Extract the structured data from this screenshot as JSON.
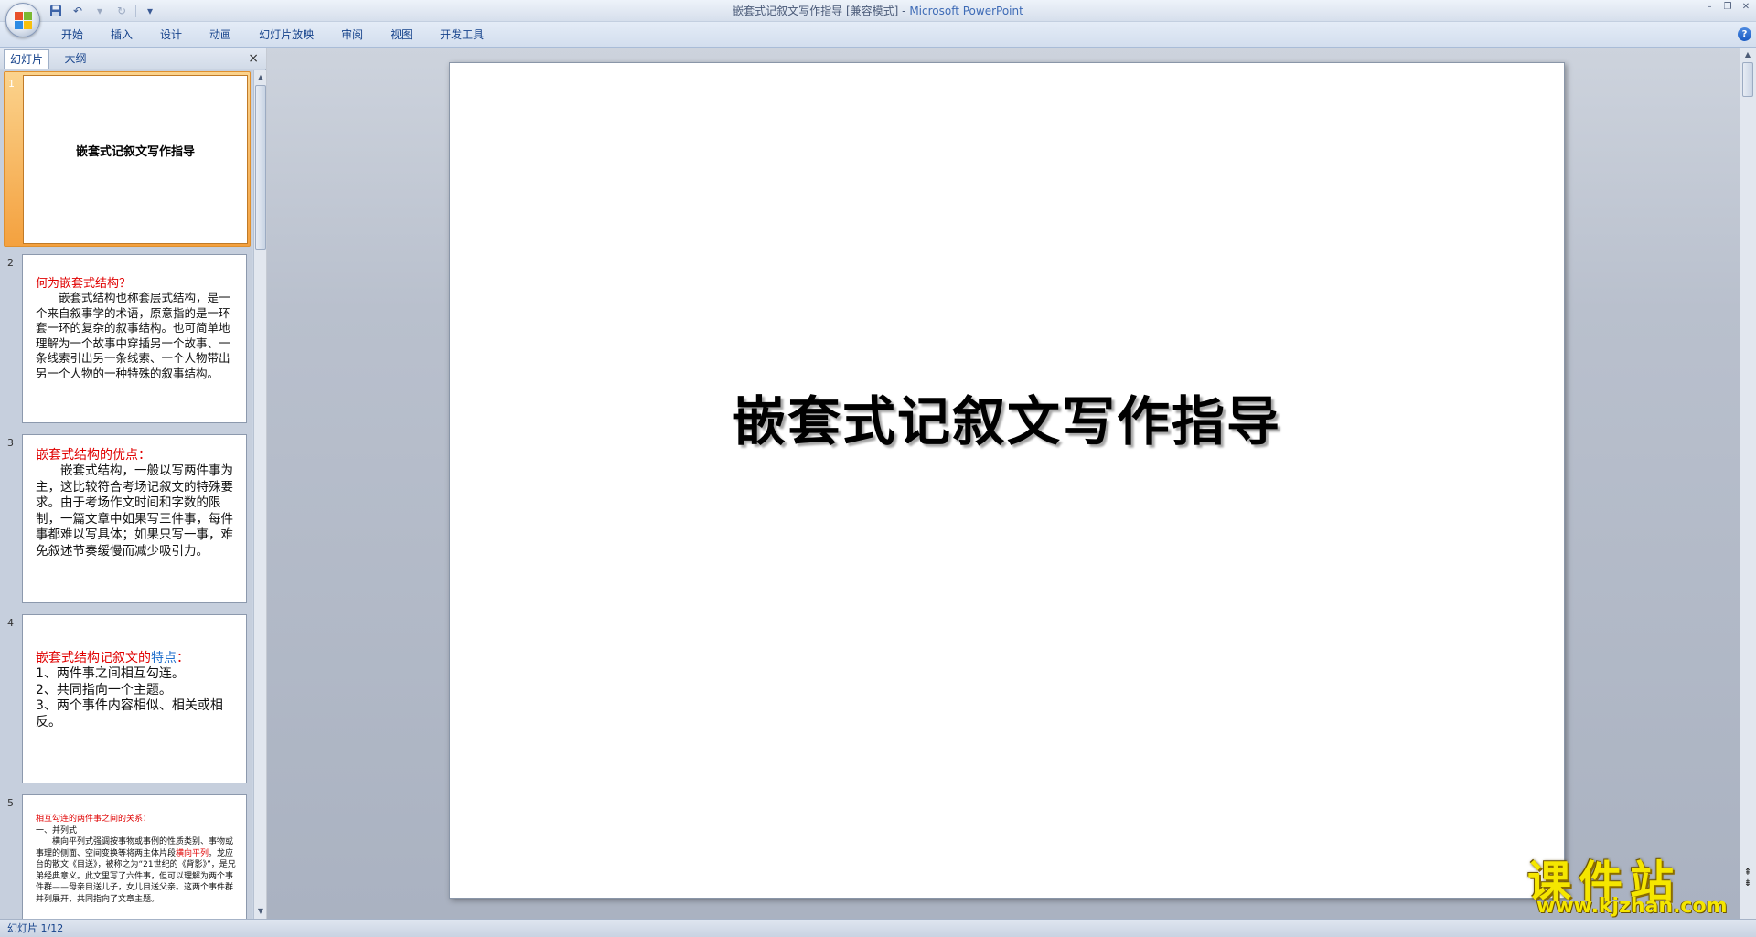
{
  "window": {
    "doc_title": "嵌套式记叙文写作指导 [兼容模式]",
    "separator": " - ",
    "app_name": "Microsoft PowerPoint"
  },
  "ribbon": {
    "tabs": [
      "开始",
      "插入",
      "设计",
      "动画",
      "幻灯片放映",
      "审阅",
      "视图",
      "开发工具"
    ]
  },
  "left_pane": {
    "tab_slides": "幻灯片",
    "tab_outline": "大纲",
    "close": "×"
  },
  "thumbnails": {
    "nums": [
      "1",
      "2",
      "3",
      "4",
      "5"
    ],
    "s1": {
      "title": "嵌套式记叙文写作指导"
    },
    "s2": {
      "heading": "何为嵌套式结构？",
      "body": "　　嵌套式结构也称套层式结构，是一个来自叙事学的术语，原意指的是一环套一环的复杂的叙事结构。也可简单地理解为一个故事中穿插另一个故事、一条线索引出另一条线索、一个人物带出另一个人物的一种特殊的叙事结构。"
    },
    "s3": {
      "heading": "嵌套式结构的优点：",
      "body": "　　嵌套式结构，一般以写两件事为主，这比较符合考场记叙文的特殊要求。由于考场作文时间和字数的限制，一篇文章中如果写三件事，每件事都难以写具体；如果只写一事，难免叙述节奏缓慢而减少吸引力。"
    },
    "s4": {
      "heading_red": "嵌套式结构记叙文的",
      "heading_blue": "特点",
      "heading_colon": "：",
      "items": [
        "1、两件事之间相互勾连。",
        "2、共同指向一个主题。",
        "3、两个事件内容相似、相关或相反。"
      ]
    },
    "s5": {
      "heading": "相互勾连的两件事之间的关系：",
      "sub": "一、并列式",
      "body_a": "　　横向平列式强调按事物或事例的性质类别、事物或事理的侧面、空间变换等将两主体片段",
      "body_red": "横向平列",
      "body_b": "。龙应台的散文《目送》，被称之为“21世纪的《背影》”，是兄弟经典意义。此文里写了六件事，但可以理解为两个事件群——母亲目送儿子，女儿目送父亲。这两个事件群并列展开，共同指向了文章主题。"
    }
  },
  "slide": {
    "title": "嵌套式记叙文写作指导"
  },
  "status": {
    "slide_indicator": "幻灯片 1/12"
  },
  "watermark": {
    "cn": "课件站",
    "url": "www.kjzhan.com"
  },
  "colors": {
    "accent_blue": "#15428b",
    "selection_orange": "#f4a13f",
    "heading_red": "#e00000",
    "watermark_yellow": "#f5e600"
  }
}
